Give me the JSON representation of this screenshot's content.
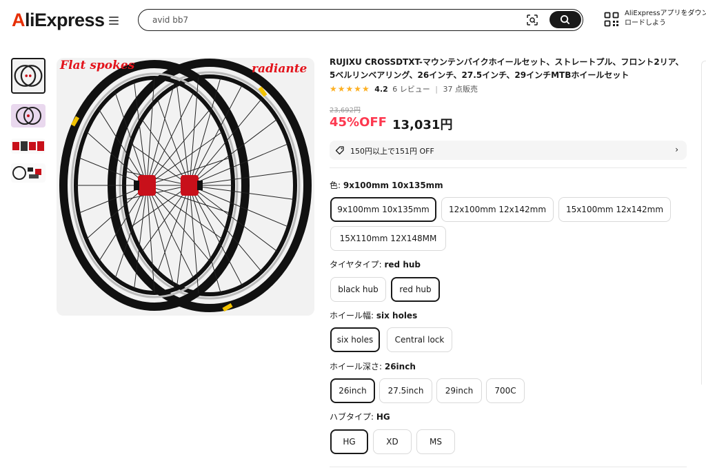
{
  "header": {
    "logo_text_a": "A",
    "logo_text_rest": "liExpress",
    "search_value": "avid bb7",
    "app_promo_line1": "AliExpressアプリをダウン",
    "app_promo_line2": "ロードしよう"
  },
  "image": {
    "label_left": "Flat spokes",
    "label_right": "radiante"
  },
  "product": {
    "title": "RUJIXU CROSSDTXT-マウンテンバイクホイールセット、ストレートプル、フロント2リア、5ベルリンベアリング、26インチ、27.5インチ、29インチMTBホイールセット",
    "stars": "★★★★★",
    "rating": "4.2",
    "reviews": "6 レビュー",
    "separator": "|",
    "sold": "37 点販売",
    "old_price": "23,692円",
    "discount": "45%OFF",
    "price": "13,031円",
    "coupon": "150円以上で151円 OFF"
  },
  "options": [
    {
      "label": "色: ",
      "selected": "9x100mm 10x135mm",
      "values": [
        "9x100mm 10x135mm",
        "12x100mm 12x142mm",
        "15x100mm 12x142mm",
        "15X110mm 12X148MM"
      ]
    },
    {
      "label": "タイヤタイプ: ",
      "selected": "red hub",
      "values": [
        "black hub",
        "red hub"
      ]
    },
    {
      "label": "ホイール幅: ",
      "selected": "six holes",
      "values": [
        "six holes",
        "Central lock"
      ]
    },
    {
      "label": "ホイール深さ: ",
      "selected": "26inch",
      "values": [
        "26inch",
        "27.5inch",
        "29inch",
        "700C"
      ]
    },
    {
      "label": "ハブタイプ: ",
      "selected": "HG",
      "values": [
        "HG",
        "XD",
        "MS"
      ]
    }
  ],
  "colors": {
    "accent_red": "#fd384f",
    "star_yellow": "#fdb022",
    "brand_red": "#e62e04"
  }
}
